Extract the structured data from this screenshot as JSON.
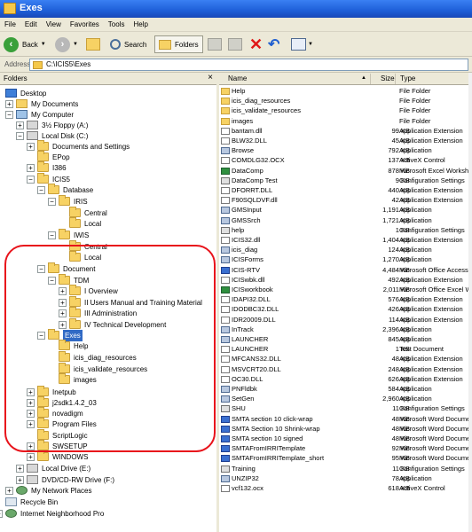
{
  "window": {
    "title": "Exes"
  },
  "menu": [
    "File",
    "Edit",
    "View",
    "Favorites",
    "Tools",
    "Help"
  ],
  "toolbar": {
    "back": "Back",
    "search": "Search",
    "folders": "Folders"
  },
  "address": {
    "label": "Address",
    "value": "C:\\ICIS5\\Exes"
  },
  "folders_pane": {
    "title": "Folders",
    "close": "×"
  },
  "tree": [
    {
      "label": "Desktop",
      "icon": "desktop-icon"
    },
    {
      "label": "My Documents",
      "icon": "my-documents-icon"
    },
    {
      "label": "My Computer",
      "icon": "my-computer-icon"
    },
    {
      "label": "3½ Floppy (A:)",
      "icon": "floppy-icon"
    },
    {
      "label": "Local Disk (C:)",
      "icon": "drive-icon"
    },
    {
      "label": "Documents and Settings",
      "icon": "folder-icon"
    },
    {
      "label": "EPop",
      "icon": "folder-icon"
    },
    {
      "label": "I386",
      "icon": "folder-icon"
    },
    {
      "label": "ICIS5",
      "icon": "folder-icon"
    },
    {
      "label": "Database",
      "icon": "folder-icon"
    },
    {
      "label": "IRIS",
      "icon": "folder-icon"
    },
    {
      "label": "Central",
      "icon": "folder-icon"
    },
    {
      "label": "Local",
      "icon": "folder-icon"
    },
    {
      "label": "IWIS",
      "icon": "folder-icon"
    },
    {
      "label": "Central",
      "icon": "folder-icon"
    },
    {
      "label": "Local",
      "icon": "folder-icon"
    },
    {
      "label": "Document",
      "icon": "folder-icon"
    },
    {
      "label": "TDM",
      "icon": "folder-icon"
    },
    {
      "label": "I Overview",
      "icon": "folder-icon"
    },
    {
      "label": "II Users Manual and Training Material",
      "icon": "folder-icon"
    },
    {
      "label": "III Administration",
      "icon": "folder-icon"
    },
    {
      "label": "IV Technical Development",
      "icon": "folder-icon"
    },
    {
      "label": "Exes",
      "icon": "folder-icon"
    },
    {
      "label": "Help",
      "icon": "folder-icon"
    },
    {
      "label": "icis_diag_resources",
      "icon": "folder-icon"
    },
    {
      "label": "icis_validate_resources",
      "icon": "folder-icon"
    },
    {
      "label": "images",
      "icon": "folder-icon"
    },
    {
      "label": "Inetpub",
      "icon": "folder-icon"
    },
    {
      "label": "j2sdk1.4.2_03",
      "icon": "folder-icon"
    },
    {
      "label": "novadigm",
      "icon": "folder-icon"
    },
    {
      "label": "Program Files",
      "icon": "folder-icon"
    },
    {
      "label": "ScriptLogic",
      "icon": "folder-icon"
    },
    {
      "label": "SWSETUP",
      "icon": "folder-icon"
    },
    {
      "label": "WINDOWS",
      "icon": "folder-icon"
    },
    {
      "label": "Local Drive (E:)",
      "icon": "drive-icon"
    },
    {
      "label": "DVD/CD-RW Drive (F:)",
      "icon": "cd-drive-icon"
    },
    {
      "label": "My Network Places",
      "icon": "network-icon"
    },
    {
      "label": "Recycle Bin",
      "icon": "recycle-bin-icon"
    },
    {
      "label": "Internet Neighborhood Pro",
      "icon": "network-icon"
    }
  ],
  "columns": {
    "name": "Name",
    "size": "Size",
    "type": "Type",
    "sort_indicator": "▲"
  },
  "files": [
    {
      "name": "Help",
      "size": "",
      "type": "File Folder",
      "icon": "folder"
    },
    {
      "name": "icis_diag_resources",
      "size": "",
      "type": "File Folder",
      "icon": "folder"
    },
    {
      "name": "icis_validate_resources",
      "size": "",
      "type": "File Folder",
      "icon": "folder"
    },
    {
      "name": "images",
      "size": "",
      "type": "File Folder",
      "icon": "folder"
    },
    {
      "name": "bantam.dll",
      "size": "99 KB",
      "type": "Application Extension",
      "icon": "file"
    },
    {
      "name": "BLW32.DLL",
      "size": "45 KB",
      "type": "Application Extension",
      "icon": "file"
    },
    {
      "name": "Browse",
      "size": "792 KB",
      "type": "Application",
      "icon": "app"
    },
    {
      "name": "COMDLG32.OCX",
      "size": "137 KB",
      "type": "ActiveX Control",
      "icon": "file"
    },
    {
      "name": "DataComp",
      "size": "878 KB",
      "type": "Microsoft Excel Worksheet",
      "icon": "xls"
    },
    {
      "name": "DataComp Test",
      "size": "9 KB",
      "type": "Configuration Settings",
      "icon": "cfg"
    },
    {
      "name": "DFORRT.DLL",
      "size": "440 KB",
      "type": "Application Extension",
      "icon": "file"
    },
    {
      "name": "F90SQLDVF.dll",
      "size": "42 KB",
      "type": "Application Extension",
      "icon": "file"
    },
    {
      "name": "GMSInput",
      "size": "1,191 KB",
      "type": "Application",
      "icon": "app"
    },
    {
      "name": "GMSSrch",
      "size": "1,721 KB",
      "type": "Application",
      "icon": "app"
    },
    {
      "name": "help",
      "size": "1 KB",
      "type": "Configuration Settings",
      "icon": "cfg"
    },
    {
      "name": "ICIS32.dll",
      "size": "1,404 KB",
      "type": "Application Extension",
      "icon": "file"
    },
    {
      "name": "icis_diag",
      "size": "124 KB",
      "type": "Application",
      "icon": "app"
    },
    {
      "name": "ICISForms",
      "size": "1,270 KB",
      "type": "Application",
      "icon": "app"
    },
    {
      "name": "ICIS-RTV",
      "size": "4,484 KB",
      "type": "Microsoft Office Access Database",
      "icon": "word"
    },
    {
      "name": "ICISwbk.dll",
      "size": "492 KB",
      "type": "Application Extension",
      "icon": "file"
    },
    {
      "name": "ICISworkbook",
      "size": "2,011 KB",
      "type": "Microsoft Office Excel Worksheet",
      "icon": "xls"
    },
    {
      "name": "IDAPI32.DLL",
      "size": "576 KB",
      "type": "Application Extension",
      "icon": "file"
    },
    {
      "name": "IDODBC32.DLL",
      "size": "426 KB",
      "type": "Application Extension",
      "icon": "file"
    },
    {
      "name": "IDR20009.DLL",
      "size": "114 KB",
      "type": "Application Extension",
      "icon": "file"
    },
    {
      "name": "InTrack",
      "size": "2,396 KB",
      "type": "Application",
      "icon": "app"
    },
    {
      "name": "LAUNCHER",
      "size": "845 KB",
      "type": "Application",
      "icon": "app"
    },
    {
      "name": "LAUNCHER",
      "size": "1 KB",
      "type": "Text Document",
      "icon": "file"
    },
    {
      "name": "MFCANS32.DLL",
      "size": "48 KB",
      "type": "Application Extension",
      "icon": "file"
    },
    {
      "name": "MSVCRT20.DLL",
      "size": "248 KB",
      "type": "Application Extension",
      "icon": "file"
    },
    {
      "name": "OC30.DLL",
      "size": "626 KB",
      "type": "Application Extension",
      "icon": "file"
    },
    {
      "name": "PNFldbk",
      "size": "584 KB",
      "type": "Application",
      "icon": "app"
    },
    {
      "name": "SetGen",
      "size": "2,960 KB",
      "type": "Application",
      "icon": "app"
    },
    {
      "name": "SHU",
      "size": "11 KB",
      "type": "Configuration Settings",
      "icon": "cfg"
    },
    {
      "name": "SMTA section 10 click-wrap",
      "size": "48 KB",
      "type": "Microsoft Word Document",
      "icon": "word"
    },
    {
      "name": "SMTA Section 10 Shrink-wrap",
      "size": "48 KB",
      "type": "Microsoft Word Document",
      "icon": "word"
    },
    {
      "name": "SMTA section 10 signed",
      "size": "48 KB",
      "type": "Microsoft Word Document",
      "icon": "word"
    },
    {
      "name": "SMTAFromIRRITemplate",
      "size": "92 KB",
      "type": "Microsoft Word Document",
      "icon": "word"
    },
    {
      "name": "SMTAFromIRRITemplate_short",
      "size": "95 KB",
      "type": "Microsoft Word Document",
      "icon": "word"
    },
    {
      "name": "Training",
      "size": "11 KB",
      "type": "Configuration Settings",
      "icon": "cfg"
    },
    {
      "name": "UNZIP32",
      "size": "78 KB",
      "type": "Application",
      "icon": "app"
    },
    {
      "name": "vcf132.ocx",
      "size": "618 KB",
      "type": "ActiveX Control",
      "icon": "file"
    }
  ]
}
